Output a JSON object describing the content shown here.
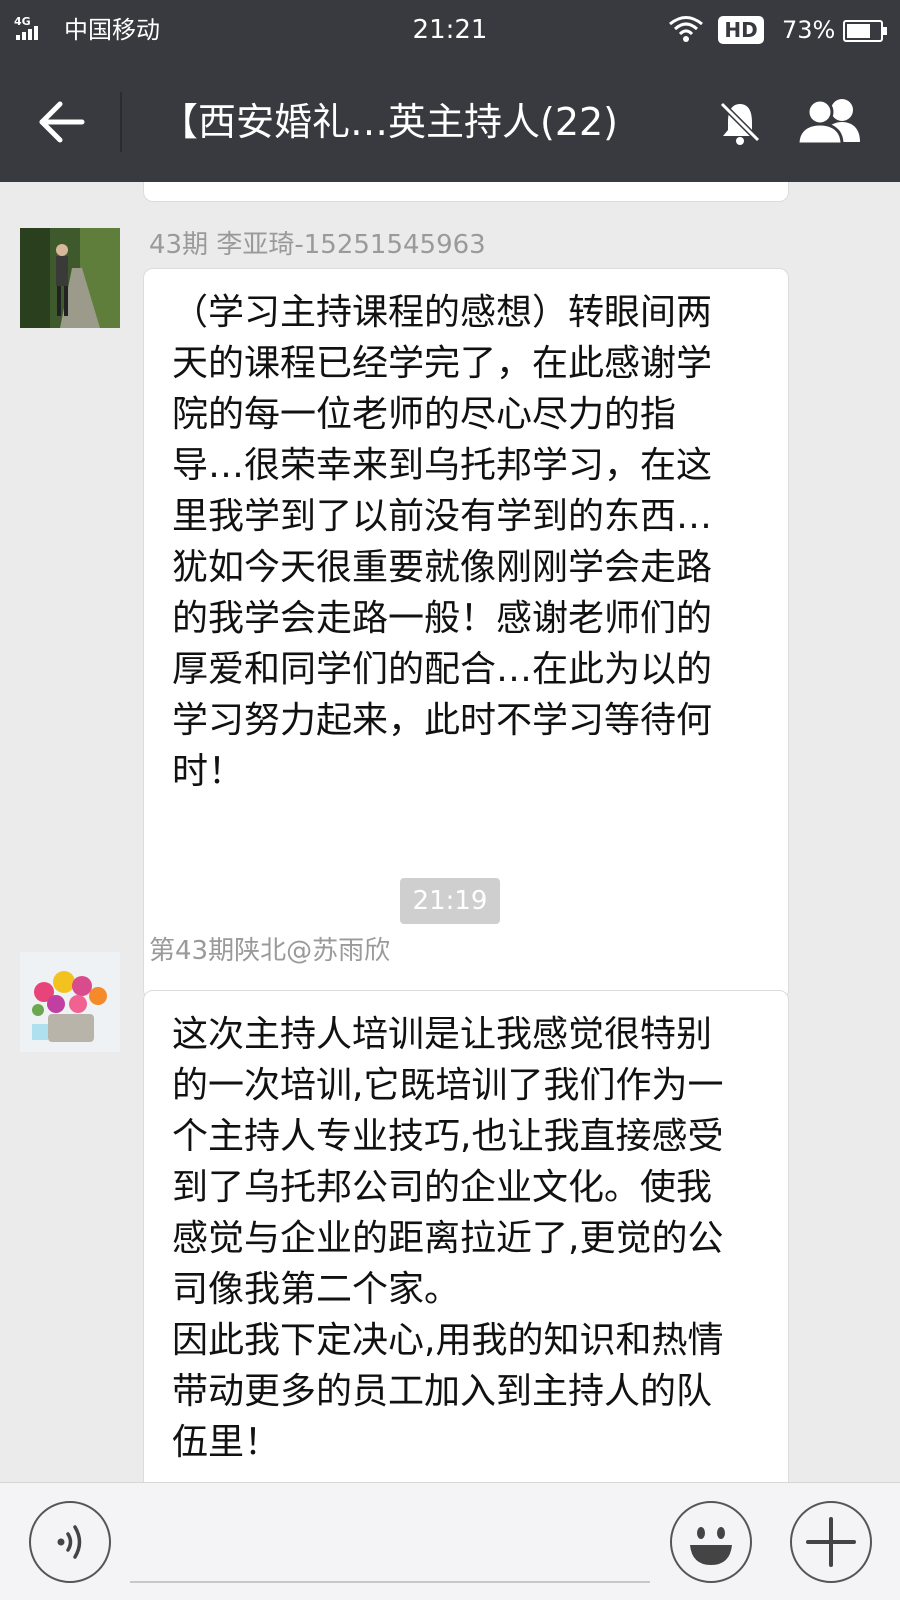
{
  "status_bar": {
    "network": "4G",
    "carrier": "中国移动",
    "time": "21:21",
    "hd_badge": "HD",
    "battery_percent": "73%",
    "battery_level": 0.73,
    "icons": [
      "signal-icon",
      "wifi-icon",
      "battery-icon"
    ]
  },
  "header": {
    "title": "【西安婚礼…英主持人(22)",
    "icons": [
      "back-arrow-icon",
      "mute-bell-icon",
      "group-members-icon"
    ]
  },
  "messages": [
    {
      "sender": "43期 李亚琦-15251545963",
      "avatar": "person-photo-avatar",
      "lines": [
        "（学习主持课程的感想）转眼间两",
        "天的课程已经学完了，在此感谢学",
        "院的每一位老师的尽心尽力的指",
        "导…很荣幸来到乌托邦学习，在这",
        "里我学到了以前没有学到的东西…",
        "犹如今天很重要就像刚刚学会走路",
        "的我学会走路一般！感谢老师们的",
        "厚爱和同学们的配合…在此为以的",
        "学习努力起来，此时不学习等待何",
        "时！"
      ]
    },
    {
      "sender": "第43期陕北@苏雨欣",
      "avatar": "flower-basket-avatar",
      "lines": [
        "这次主持人培训是让我感觉很特别",
        "的一次培训,它既培训了我们作为一",
        "个主持人专业技巧,也让我直接感受",
        "到了乌托邦公司的企业文化。使我",
        "感觉与企业的距离拉近了,更觉的公",
        "司像我第二个家。",
        "因此我下定决心,用我的知识和热情",
        "带动更多的员工加入到主持人的队",
        "伍里！"
      ]
    }
  ],
  "timestamp": "21:19",
  "input_bar": {
    "icons": [
      "voice-icon",
      "emoji-icon",
      "plus-icon"
    ],
    "text_value": ""
  },
  "colors": {
    "header_bg": "#393a3f",
    "chat_bg": "#ebebeb",
    "bubble_bg": "#ffffff",
    "sender_text": "#9a9a9a",
    "timestamp_bg": "#cfcfcf"
  }
}
